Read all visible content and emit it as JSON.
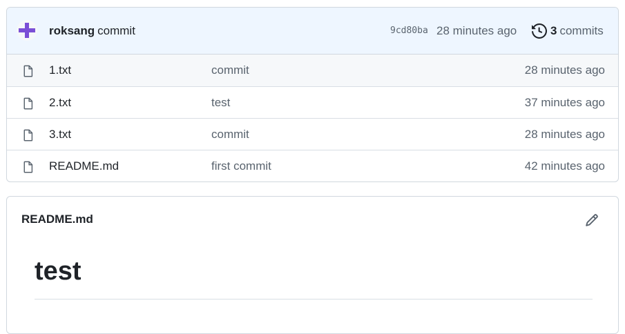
{
  "commit": {
    "author": "roksang",
    "message": "commit",
    "sha": "9cd80ba",
    "time": "28 minutes ago",
    "commit_count": "3",
    "commits_label": "commits"
  },
  "files": [
    {
      "name": "1.txt",
      "message": "commit",
      "time": "28 minutes ago"
    },
    {
      "name": "2.txt",
      "message": "test",
      "time": "37 minutes ago"
    },
    {
      "name": "3.txt",
      "message": "commit",
      "time": "28 minutes ago"
    },
    {
      "name": "README.md",
      "message": "first commit",
      "time": "42 minutes ago"
    }
  ],
  "readme": {
    "title": "README.md",
    "heading": "test"
  },
  "icons": {
    "avatar": "identicon-avatar",
    "history": "history-icon",
    "file": "file-icon",
    "edit": "pencil-icon"
  },
  "colors": {
    "commit_bar_bg": "#eef6ff",
    "avatar_accent": "#7b4fd6",
    "muted_text": "#59636e",
    "border": "#d0d7de"
  }
}
